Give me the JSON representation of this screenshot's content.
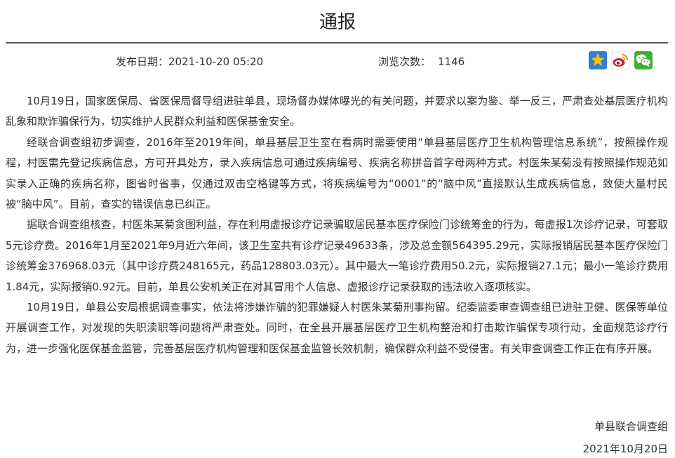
{
  "header": {
    "title": "通报"
  },
  "meta": {
    "publish_date": "发布日期：2021-10-20 05:20",
    "views_label": "浏览次数：",
    "views_count": "1146"
  },
  "share_icons": {
    "qzone": "qzone-star-icon",
    "weibo": "weibo-icon",
    "wechat": "wechat-icon"
  },
  "colors": {
    "qzone_blue": "#2f7fd6",
    "qzone_star": "#f6c21c",
    "weibo_red": "#e6162d",
    "wechat_green": "#3cb034"
  },
  "article": {
    "paragraphs": [
      "10月19日，国家医保局、省医保局督导组进驻单县，现场督办媒体曝光的有关问题，并要求以案为鉴、举一反三，严肃查处基层医疗机构乱象和欺诈骗保行为，切实维护人民群众利益和医保基金安全。",
      "经联合调查组初步调查，2016年至2019年间，单县基层卫生室在看病时需要使用“单县基层医疗卫生机构管理信息系统”，按照操作规程，村医需先登记疾病信息，方可开具处方，录入疾病信息可通过疾病编号、疾病名称拼音首字母两种方式。村医朱某菊没有按照操作规范如实录入正确的疾病名称，图省时省事，仅通过双击空格键等方式，将疾病编号为“0001”的“脑中风”直接默认生成疾病信息，致使大量村民被“脑中风”。目前，查实的错误信息已纠正。",
      "据联合调查组核查，村医朱某菊贪图利益，存在利用虚报诊疗记录骗取居民基本医疗保险门诊统筹金的行为，每虚报1次诊疗记录，可套取5元诊疗费。2016年1月至2021年9月近六年间，该卫生室共有诊疗记录49633条，涉及总金额564395.29元，实际报销居民基本医疗保险门诊统筹金376968.03元（其中诊疗费248165元，药品128803.03元）。其中最大一笔诊疗费用50.2元，实际报销27.1元；最小一笔诊疗费用1.84元，实际报销0.92元。目前，单县公安机关正在对其冒用个人信息、虚报诊疗记录获取的违法收入逐项核实。",
      "10月19日，单县公安局根据调查事实，依法将涉嫌诈骗的犯罪嫌疑人村医朱某菊刑事拘留。纪委监委审查调查组已进驻卫健、医保等单位开展调查工作，对发现的失职渎职等问题将严肃查处。同时，在全县开展基层医疗卫生机构整治和打击欺诈骗保专项行动，全面规范诊疗行为，进一步强化医保基金监管，完善基层医疗机构管理和医保基金监管长效机制，确保群众利益不受侵害。有关审查调查工作正在有序开展。"
    ]
  },
  "signature": {
    "org": "单县联合调查组",
    "date": "2021年10月20日"
  }
}
